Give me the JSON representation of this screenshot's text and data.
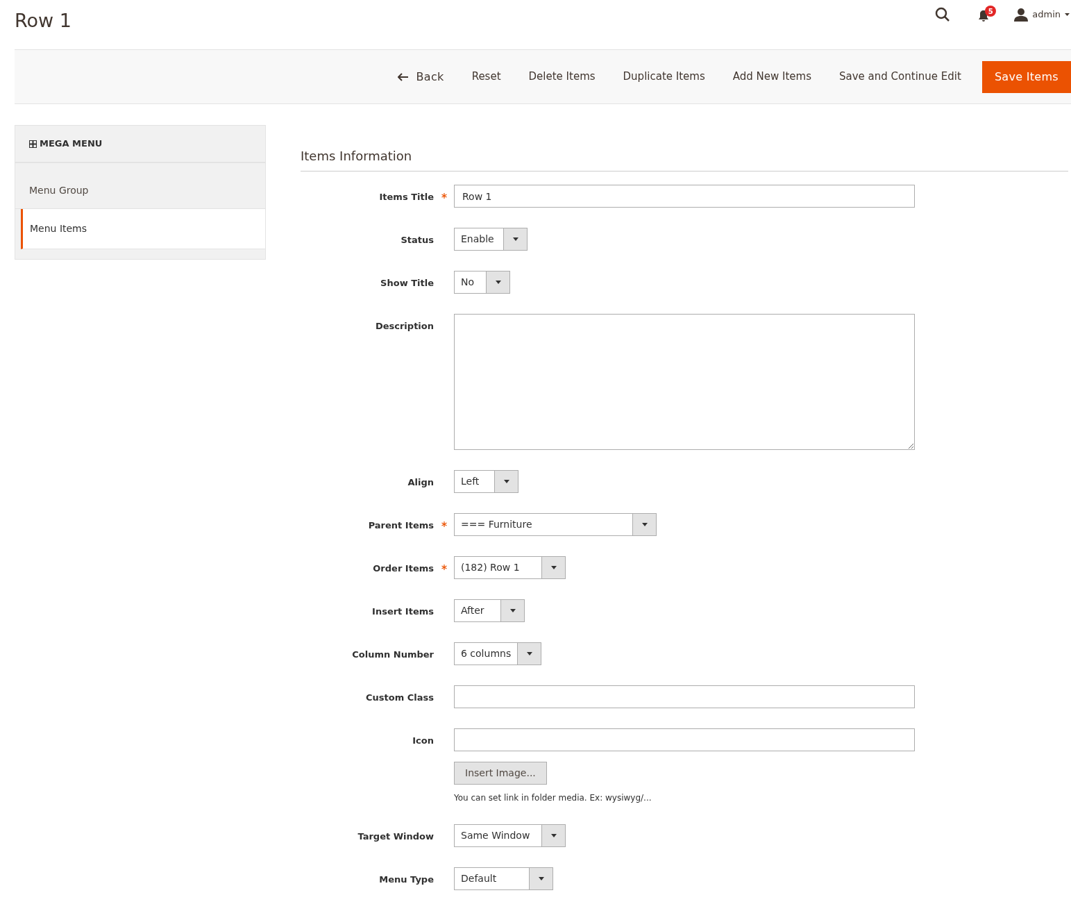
{
  "page_title": "Row 1",
  "header": {
    "notifications": "5",
    "user": "admin"
  },
  "toolbar": [
    {
      "label": "Back",
      "kind": "back"
    },
    {
      "label": "Reset",
      "kind": "plain"
    },
    {
      "label": "Delete Items",
      "kind": "plain"
    },
    {
      "label": "Duplicate Items",
      "kind": "plain"
    },
    {
      "label": "Add New Items",
      "kind": "plain"
    },
    {
      "label": "Save and Continue Edit",
      "kind": "plain"
    },
    {
      "label": "Save Items",
      "kind": "primary"
    }
  ],
  "sidebar": {
    "title": "MEGA MENU",
    "items": [
      {
        "label": "Menu Group",
        "selected": false
      },
      {
        "label": "Menu Items",
        "selected": true
      }
    ]
  },
  "section_title": "Items Information",
  "fields": [
    {
      "label": "Items Title",
      "kind": "text",
      "required": true,
      "value": "Row 1"
    },
    {
      "label": "Status",
      "kind": "select",
      "required": false,
      "value": "Enable"
    },
    {
      "label": "Show Title",
      "kind": "select",
      "required": false,
      "value": "No"
    },
    {
      "label": "Description",
      "kind": "textarea",
      "required": false
    },
    {
      "label": "Align",
      "kind": "select",
      "required": false,
      "value": "Left"
    },
    {
      "label": "Parent Items",
      "kind": "select",
      "required": true,
      "value": "=== Furniture"
    },
    {
      "label": "Order Items",
      "kind": "select",
      "required": true,
      "value": "(182) Row 1"
    },
    {
      "label": "Insert Items",
      "kind": "select",
      "required": false,
      "value": "After"
    },
    {
      "label": "Column Number",
      "kind": "select",
      "required": false,
      "value": "6 columns"
    },
    {
      "label": "Custom Class",
      "kind": "text",
      "required": false
    },
    {
      "label": "Icon",
      "kind": "text",
      "required": false,
      "button": "Insert Image...",
      "note": "You can set link in folder media. Ex: wysiwyg/..."
    },
    {
      "label": "Target Window",
      "kind": "select",
      "required": false,
      "value": "Same Window"
    },
    {
      "label": "Menu Type",
      "kind": "select",
      "required": false,
      "value": "Default"
    }
  ]
}
